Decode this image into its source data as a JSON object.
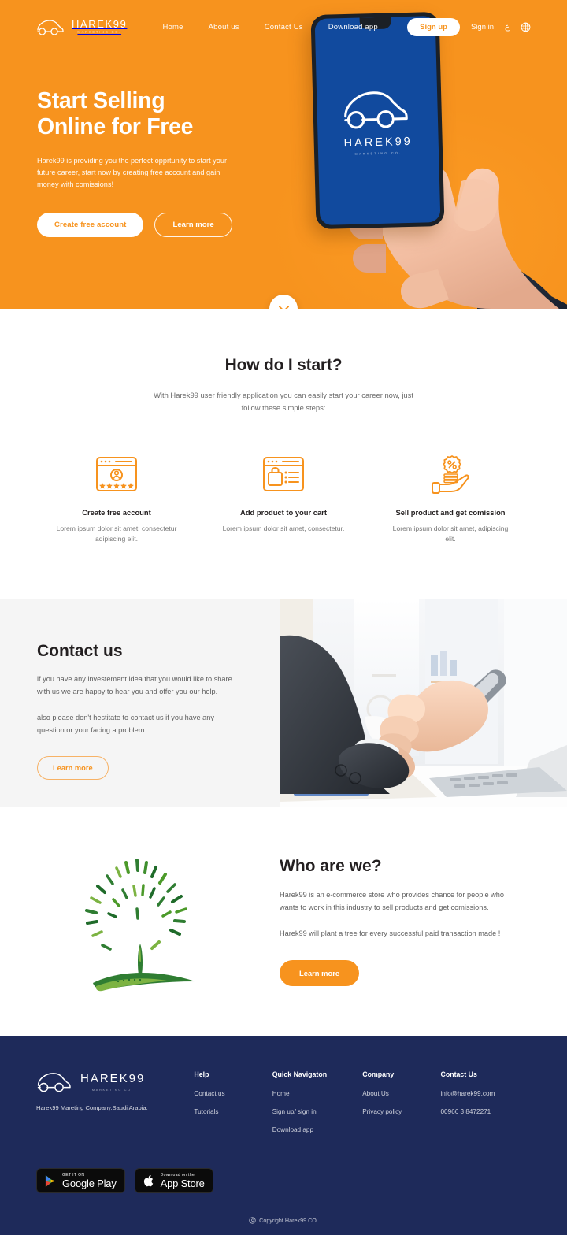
{
  "brand": {
    "name": "HAREK99",
    "sub": "MARKETING CO.",
    "logo_icon": "car-outline-icon"
  },
  "header": {
    "nav": [
      {
        "label": "Home"
      },
      {
        "label": "About us"
      },
      {
        "label": "Contact Us"
      },
      {
        "label": "Download app"
      }
    ],
    "signup_label": "Sign up",
    "signin_label": "Sign in",
    "lang_label": "ع",
    "globe_icon": "globe-icon"
  },
  "hero": {
    "title_line1": "Start Selling",
    "title_line2": "Online for Free",
    "description": "Harek99 is providing you the perfect opprtunity to start your future career, start now by creating free account and gain money with comissions!",
    "primary_btn": "Create free account",
    "secondary_btn": "Learn more",
    "phone_logo_name": "HAREK99",
    "phone_logo_sub": "MARKETING CO.",
    "scroll_icon": "chevron-down-icon",
    "bg_color": "#f7931e",
    "phone_screen_color": "#114a9e"
  },
  "steps_section": {
    "title": "How do I start?",
    "subtitle": "With Harek99 user friendly application you can easily start your career now, just follow these simple steps:",
    "items": [
      {
        "icon": "browser-user-rating-icon",
        "title": "Create free account",
        "desc": "Lorem ipsum dolor sit amet, consectetur adipiscing elit."
      },
      {
        "icon": "browser-shopping-bag-icon",
        "title": "Add product to your cart",
        "desc": "Lorem ipsum dolor sit amet, consectetur."
      },
      {
        "icon": "hand-coins-percent-icon",
        "title": "Sell product and get comission",
        "desc": "Lorem ipsum dolor sit amet, adipiscing elit."
      }
    ],
    "accent_color": "#f7931e"
  },
  "contact_section": {
    "title": "Contact us",
    "paragraph1": "if you have any investement idea that you would like to share with us we are happy to hear you and offer you our help.",
    "paragraph2": "also please don't hestitate to contact us if you have any question or your facing a problem.",
    "button": "Learn more",
    "photo_alt": "businessperson-using-smartphone-at-desk",
    "bg_color": "#f5f5f5"
  },
  "who_section": {
    "title": "Who are we?",
    "paragraph1": "Harek99 is an e-commerce store who provides chance for people who wants to work in this industry to sell products and get comissions.",
    "paragraph2": "Harek99 will plant a tree for every successful paid transaction made !",
    "button": "Learn more",
    "illustration": "green-tree-illustration"
  },
  "footer": {
    "tagline": "Harek99 Mareting Company.Saudi Arabia.",
    "columns": [
      {
        "title": "Help",
        "links": [
          "Contact us",
          "Tutorials"
        ]
      },
      {
        "title": "Quick Navigaton",
        "links": [
          "Home",
          "Sign up/ sign in",
          "Download app"
        ]
      },
      {
        "title": "Company",
        "links": [
          "About Us",
          "Privacy policy"
        ]
      },
      {
        "title": "Contact Us",
        "links": [
          "info@harek99.com",
          "00966 3 8472271"
        ]
      }
    ],
    "stores": [
      {
        "icon": "google-play-icon",
        "small": "GET IT ON",
        "large": "Google Play"
      },
      {
        "icon": "apple-icon",
        "small": "Download on the",
        "large": "App Store"
      }
    ],
    "copyright": "Copyright Harek99 CO.",
    "copyright_icon": "copyright-icon",
    "bg_color": "#1e2a5a"
  }
}
